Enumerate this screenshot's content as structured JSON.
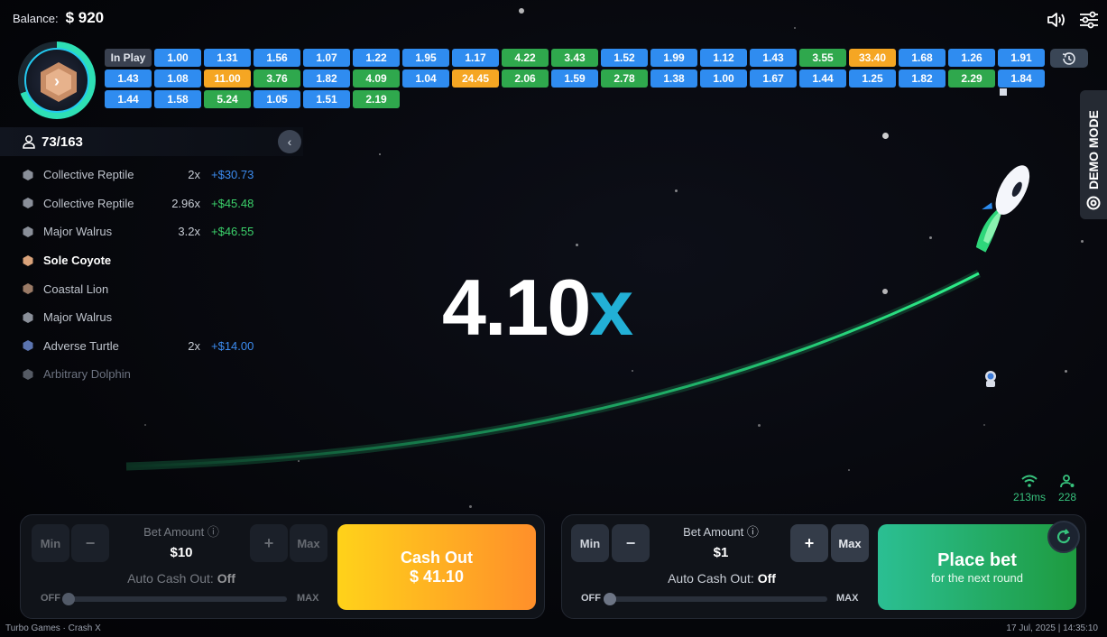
{
  "balance": {
    "label": "Balance:",
    "value": "$ 920"
  },
  "history": {
    "inplay_label": "In Play",
    "rows": [
      [
        {
          "v": "1.00",
          "c": "blue"
        },
        {
          "v": "1.31",
          "c": "blue"
        },
        {
          "v": "1.56",
          "c": "blue"
        },
        {
          "v": "1.07",
          "c": "blue"
        },
        {
          "v": "1.22",
          "c": "blue"
        },
        {
          "v": "1.95",
          "c": "blue"
        },
        {
          "v": "1.17",
          "c": "blue"
        },
        {
          "v": "4.22",
          "c": "green"
        },
        {
          "v": "3.43",
          "c": "green"
        },
        {
          "v": "1.52",
          "c": "blue"
        },
        {
          "v": "1.99",
          "c": "blue"
        },
        {
          "v": "1.12",
          "c": "blue"
        },
        {
          "v": "1.43",
          "c": "blue"
        },
        {
          "v": "3.55",
          "c": "green"
        },
        {
          "v": "33.40",
          "c": "orange"
        },
        {
          "v": "1.68",
          "c": "blue"
        },
        {
          "v": "1.26",
          "c": "blue"
        },
        {
          "v": "1.91",
          "c": "blue"
        }
      ],
      [
        {
          "v": "1.43",
          "c": "blue"
        },
        {
          "v": "1.08",
          "c": "blue"
        },
        {
          "v": "11.00",
          "c": "orange"
        },
        {
          "v": "3.76",
          "c": "green"
        },
        {
          "v": "1.82",
          "c": "blue"
        },
        {
          "v": "4.09",
          "c": "green"
        },
        {
          "v": "1.04",
          "c": "blue"
        },
        {
          "v": "24.45",
          "c": "orange"
        },
        {
          "v": "2.06",
          "c": "green"
        },
        {
          "v": "1.59",
          "c": "blue"
        },
        {
          "v": "2.78",
          "c": "green"
        },
        {
          "v": "1.38",
          "c": "blue"
        },
        {
          "v": "1.00",
          "c": "blue"
        },
        {
          "v": "1.67",
          "c": "blue"
        },
        {
          "v": "1.44",
          "c": "blue"
        },
        {
          "v": "1.25",
          "c": "blue"
        },
        {
          "v": "1.82",
          "c": "blue"
        },
        {
          "v": "2.29",
          "c": "green"
        },
        {
          "v": "1.84",
          "c": "blue"
        }
      ],
      [
        {
          "v": "1.44",
          "c": "blue"
        },
        {
          "v": "1.58",
          "c": "blue"
        },
        {
          "v": "5.24",
          "c": "green"
        },
        {
          "v": "1.05",
          "c": "blue"
        },
        {
          "v": "1.51",
          "c": "blue"
        },
        {
          "v": "2.19",
          "c": "green"
        }
      ]
    ]
  },
  "players": {
    "count": "73/163",
    "list": [
      {
        "name": "Collective Reptile",
        "mult": "2x",
        "win": "+$30.73",
        "win_color": "blue",
        "style": "",
        "icon": "#8a8f99"
      },
      {
        "name": "Collective Reptile",
        "mult": "2.96x",
        "win": "+$45.48",
        "win_color": "green",
        "style": "",
        "icon": "#8a8f99"
      },
      {
        "name": "Major Walrus",
        "mult": "3.2x",
        "win": "+$46.55",
        "win_color": "green",
        "style": "",
        "icon": "#8a8f99"
      },
      {
        "name": "Sole Coyote",
        "mult": "",
        "win": "",
        "win_color": "",
        "style": "bold",
        "icon": "#d9a27a"
      },
      {
        "name": "Coastal Lion",
        "mult": "",
        "win": "",
        "win_color": "",
        "style": "",
        "icon": "#9a7a66"
      },
      {
        "name": "Major Walrus",
        "mult": "",
        "win": "",
        "win_color": "",
        "style": "",
        "icon": "#8a8f99"
      },
      {
        "name": "Adverse Turtle",
        "mult": "2x",
        "win": "+$14.00",
        "win_color": "blue",
        "style": "",
        "icon": "#5b74b0"
      },
      {
        "name": "Arbitrary Dolphin",
        "mult": "",
        "win": "",
        "win_color": "",
        "style": "fade",
        "icon": "#555a64"
      }
    ]
  },
  "game": {
    "multiplier": "4.10",
    "suffix": "x"
  },
  "demo_tab": "DEMO MODE",
  "network": {
    "ping": "213ms",
    "online": "228"
  },
  "panel_left": {
    "min": "Min",
    "minus": "−",
    "plus": "+",
    "max": "Max",
    "bet_label": "Bet Amount",
    "bet_value": "$10",
    "auto_label": "Auto Cash Out:",
    "auto_value": "Off",
    "off": "OFF",
    "max_lbl": "MAX",
    "btn_title": "Cash Out",
    "btn_sub": "$ 41.10"
  },
  "panel_right": {
    "min": "Min",
    "minus": "−",
    "plus": "+",
    "max": "Max",
    "bet_label": "Bet Amount",
    "bet_value": "$1",
    "auto_label": "Auto Cash Out:",
    "auto_value": "Off",
    "off": "OFF",
    "max_lbl": "MAX",
    "btn_title": "Place bet",
    "btn_sub": "for the next round"
  },
  "footer": {
    "left": "Turbo Games · Crash X",
    "right": "17 Jul, 2025 | 14:35:10"
  }
}
